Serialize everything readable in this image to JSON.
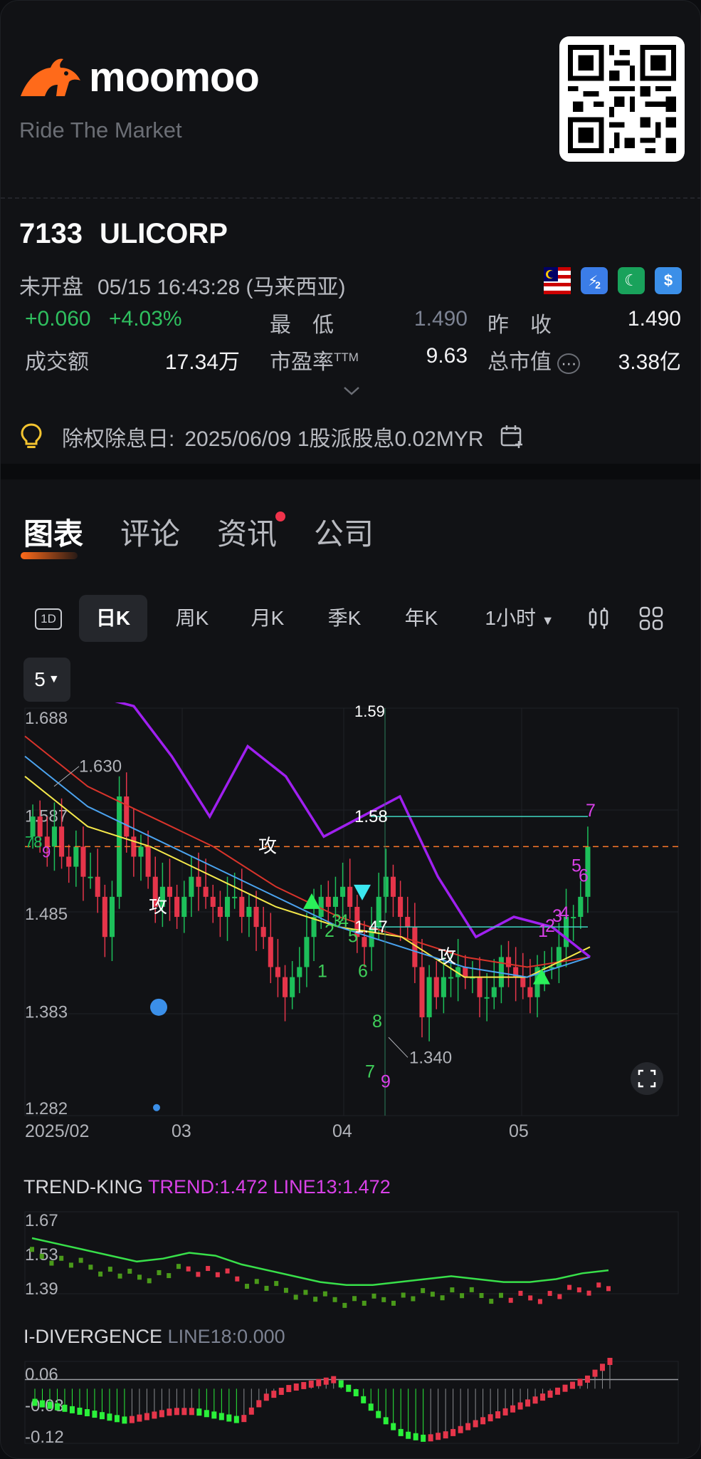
{
  "brand": {
    "name": "moomoo",
    "tagline": "Ride The Market"
  },
  "quote": {
    "code": "7133",
    "name": "ULICORP",
    "market_status": "未开盘",
    "datetime": "05/15 16:43:28 (马来西亚)",
    "change": "+0.060",
    "change_pct": "+4.03%",
    "low_label": "最　低",
    "low_value": "1.490",
    "prev_close_label": "昨　收",
    "prev_close_value": "1.490",
    "turnover_label": "成交额",
    "turnover_value": "17.34万",
    "pe_label": "市盈率",
    "pe_sup": "TTM",
    "pe_value": "9.63",
    "mktcap_label": "总市值",
    "mktcap_value": "3.38亿",
    "badges": [
      "2"
    ]
  },
  "notice": {
    "label": "除权除息日:",
    "text": "2025/06/09 1股派股息0.02MYR"
  },
  "tabs": [
    "图表",
    "评论",
    "资讯",
    "公司"
  ],
  "periods": [
    "日K",
    "周K",
    "月K",
    "季K",
    "年K",
    "1小时"
  ],
  "period_icon": "1D",
  "ma_select": "5",
  "main_chart": {
    "y_labels": [
      "1.688",
      "1.587",
      "1.485",
      "1.383",
      "1.282"
    ],
    "x_labels": [
      "2025/02",
      "03",
      "04",
      "05"
    ],
    "annotations": [
      "1.630",
      "1.340",
      "1.58",
      "1.47",
      "攻",
      "攻",
      "攻",
      "78",
      "9",
      "1.59"
    ],
    "td_counts": [
      "1",
      "2",
      "3",
      "4",
      "5",
      "6",
      "7",
      "8",
      "9"
    ]
  },
  "indicator1": {
    "name": "TREND-KING",
    "values": "TREND:1.472 LINE13:1.472",
    "y_labels": [
      "1.67",
      "1.53",
      "1.39"
    ]
  },
  "indicator2": {
    "name": "I-DIVERGENCE",
    "values": "LINE18:0.000",
    "y_labels": [
      "0.06",
      "-0.03",
      "-0.12"
    ]
  },
  "colors": {
    "up": "#e5354a",
    "down": "#1dbf5a",
    "accent": "#ff6a1a",
    "purple": "#a020f0"
  },
  "chart_data": [
    {
      "type": "candlestick",
      "title": "",
      "x": [
        "2025/02",
        "03",
        "04",
        "05"
      ],
      "ylim": [
        1.282,
        1.688
      ],
      "series": [
        {
          "name": "price_close",
          "values": [
            1.58,
            1.56,
            1.55,
            1.57,
            1.54,
            1.53,
            1.55,
            1.52,
            1.52,
            1.5,
            1.46,
            1.5,
            1.6,
            1.56,
            1.54,
            1.55,
            1.52,
            1.49,
            1.51,
            1.5,
            1.48,
            1.5,
            1.52,
            1.51,
            1.5,
            1.49,
            1.48,
            1.5,
            1.5,
            1.48,
            1.49,
            1.47,
            1.46,
            1.43,
            1.42,
            1.4,
            1.42,
            1.43,
            1.46,
            1.48,
            1.5,
            1.49,
            1.5,
            1.51,
            1.49,
            1.46,
            1.45,
            1.47,
            1.5,
            1.52,
            1.5,
            1.48,
            1.47,
            1.43,
            1.38,
            1.42,
            1.4,
            1.42,
            1.42,
            1.43,
            1.42,
            1.42,
            1.4,
            1.4,
            1.41,
            1.44,
            1.43,
            1.42,
            1.41,
            1.4,
            1.43,
            1.43,
            1.43,
            1.45,
            1.48,
            1.48,
            1.5,
            1.55
          ]
        },
        {
          "name": "ma_red",
          "values": [
            1.66,
            1.61,
            1.58,
            1.55,
            1.51,
            1.48,
            1.46,
            1.44,
            1.43,
            1.44
          ]
        },
        {
          "name": "ma_yellow",
          "values": [
            1.62,
            1.57,
            1.55,
            1.52,
            1.49,
            1.47,
            1.46,
            1.42,
            1.42,
            1.45
          ]
        },
        {
          "name": "ma_blue",
          "values": [
            1.64,
            1.59,
            1.56,
            1.53,
            1.5,
            1.47,
            1.45,
            1.43,
            1.42,
            1.44
          ]
        },
        {
          "name": "purple",
          "values": [
            1.7,
            1.7,
            1.69,
            1.64,
            1.58,
            1.65,
            1.62,
            1.56,
            1.58,
            1.6,
            1.52,
            1.46,
            1.48,
            1.47,
            1.44
          ]
        }
      ]
    },
    {
      "type": "bar",
      "name": "TREND-KING",
      "ylim": [
        1.39,
        1.67
      ],
      "series": [
        {
          "name": "TREND",
          "values": [
            1.58,
            1.56,
            1.54,
            1.52,
            1.5,
            1.51,
            1.53,
            1.52,
            1.49,
            1.47,
            1.45,
            1.43,
            1.42,
            1.42,
            1.43,
            1.44,
            1.45,
            1.44,
            1.43,
            1.43,
            1.44,
            1.46,
            1.47
          ]
        }
      ]
    },
    {
      "type": "bar",
      "name": "I-DIVERGENCE",
      "ylim": [
        -0.12,
        0.06
      ],
      "series": [
        {
          "name": "LINE18",
          "values": [
            -0.03,
            -0.04,
            -0.05,
            -0.06,
            -0.07,
            -0.06,
            -0.05,
            -0.05,
            -0.06,
            -0.07,
            -0.02,
            0.0,
            0.01,
            0.02,
            -0.01,
            -0.06,
            -0.1,
            -0.11,
            -0.1,
            -0.08,
            -0.06,
            -0.04,
            -0.02,
            0.0,
            0.02,
            0.06
          ]
        }
      ]
    }
  ]
}
